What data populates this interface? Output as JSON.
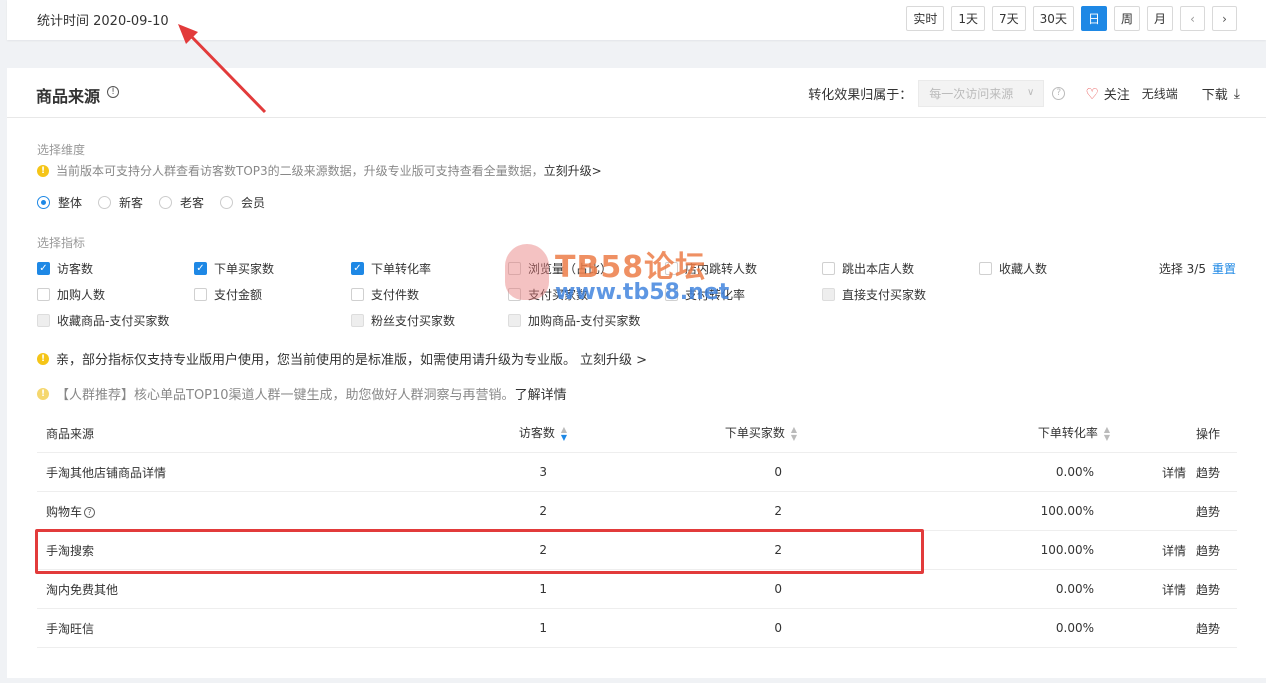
{
  "header": {
    "stat_time": "统计时间 2020-09-10",
    "ranges": [
      "实时",
      "1天",
      "7天",
      "30天",
      "日",
      "周",
      "月"
    ],
    "active_range": "日",
    "prev_icon": "chevron-left-icon",
    "next_icon": "chevron-right-icon"
  },
  "panel": {
    "title": "商品来源",
    "attr_label": "转化效果归属于：",
    "attr_value": "每一次访问来源",
    "follow_label": "关注",
    "wireless_label": "无线端",
    "download_label": "下载"
  },
  "dimension": {
    "label": "选择维度",
    "notice": "当前版本可支持分人群查看访客数TOP3的二级来源数据，升级专业版可支持查看全量数据，",
    "notice_link": "立刻升级>",
    "options": [
      "整体",
      "新客",
      "老客",
      "会员"
    ],
    "selected": "整体"
  },
  "metrics": {
    "label": "选择指标",
    "items": [
      {
        "label": "访客数",
        "state": "checked"
      },
      {
        "label": "下单买家数",
        "state": "checked"
      },
      {
        "label": "下单转化率",
        "state": "checked"
      },
      {
        "label": "浏览量（占比）",
        "state": "unchecked"
      },
      {
        "label": "店内跳转人数",
        "state": "unchecked"
      },
      {
        "label": "跳出本店人数",
        "state": "unchecked"
      },
      {
        "label": "收藏人数",
        "state": "unchecked"
      },
      {
        "label": "加购人数",
        "state": "unchecked"
      },
      {
        "label": "支付金额",
        "state": "unchecked"
      },
      {
        "label": "支付件数",
        "state": "unchecked"
      },
      {
        "label": "支付买家数",
        "state": "unchecked"
      },
      {
        "label": "支付转化率",
        "state": "unchecked"
      },
      {
        "label": "直接支付买家数",
        "state": "disabled"
      },
      {
        "label": "收藏商品-支付买家数",
        "state": "disabled"
      },
      {
        "label": "粉丝支付买家数",
        "state": "disabled"
      },
      {
        "label": "加购商品-支付买家数",
        "state": "disabled"
      }
    ],
    "select_count": "选择 3/5",
    "reset_label": "重置",
    "pro_notice": "亲，部分指标仅支持专业版用户使用，您当前使用的是标准版，如需使用请升级为专业版。",
    "pro_link": "立刻升级 >",
    "crowd_notice": "【人群推荐】核心单品TOP10渠道人群一键生成，助您做好人群洞察与再营销。",
    "crowd_link": "了解详情"
  },
  "watermark": {
    "title": "TB58论坛",
    "url": "www.tb58.net"
  },
  "table": {
    "headers": [
      "商品来源",
      "访客数",
      "下单买家数",
      "下单转化率",
      "操作"
    ],
    "rows": [
      {
        "source": "手淘其他店铺商品详情",
        "uv": "3",
        "buyers": "0",
        "rate": "0.00%",
        "detail": "详情",
        "trend": "趋势",
        "help": false
      },
      {
        "source": "购物车",
        "uv": "2",
        "buyers": "2",
        "rate": "100.00%",
        "detail": "",
        "trend": "趋势",
        "help": true
      },
      {
        "source": "手淘搜索",
        "uv": "2",
        "buyers": "2",
        "rate": "100.00%",
        "detail": "详情",
        "trend": "趋势",
        "help": false
      },
      {
        "source": "淘内免费其他",
        "uv": "1",
        "buyers": "0",
        "rate": "0.00%",
        "detail": "详情",
        "trend": "趋势",
        "help": false
      },
      {
        "source": "手淘旺信",
        "uv": "1",
        "buyers": "0",
        "rate": "0.00%",
        "detail": "",
        "trend": "趋势",
        "help": false
      }
    ]
  },
  "colors": {
    "accent": "#1e88e5",
    "annotation": "#e23b3b",
    "warning": "#f5c518"
  }
}
